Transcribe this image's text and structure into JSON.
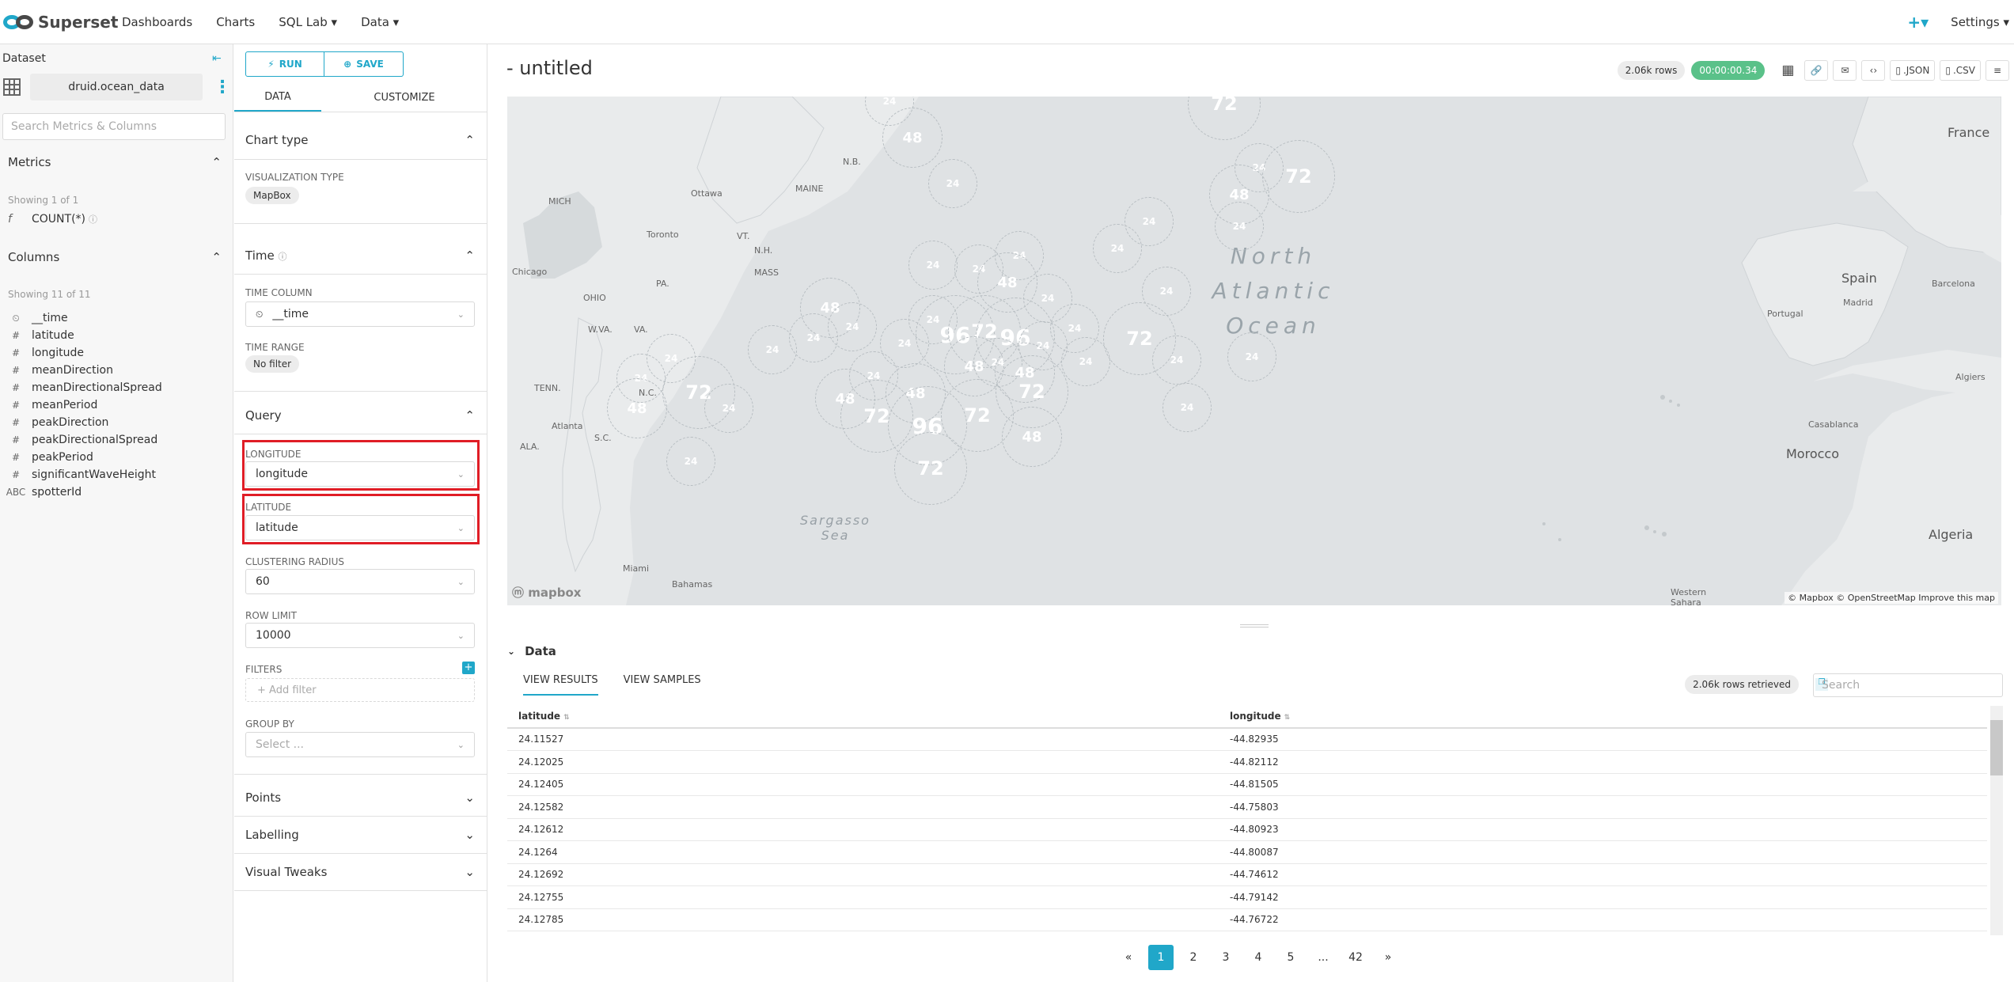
{
  "topbar": {
    "brand": "Superset",
    "nav": [
      "Dashboards",
      "Charts",
      "SQL Lab ▾",
      "Data ▾"
    ],
    "add_icon": "+▾",
    "settings": "Settings ▾"
  },
  "datasource": {
    "title": "Dataset",
    "name": "druid.ocean_data",
    "search_placeholder": "Search Metrics & Columns",
    "metrics_title": "Metrics",
    "metrics_showing": "Showing 1 of 1",
    "metrics": [
      {
        "icon": "f",
        "name": "COUNT(*)"
      }
    ],
    "columns_title": "Columns",
    "columns_showing": "Showing 11 of 11",
    "columns": [
      {
        "icon": "⏲",
        "name": "__time"
      },
      {
        "icon": "#",
        "name": "latitude"
      },
      {
        "icon": "#",
        "name": "longitude"
      },
      {
        "icon": "#",
        "name": "meanDirection"
      },
      {
        "icon": "#",
        "name": "meanDirectionalSpread"
      },
      {
        "icon": "#",
        "name": "meanPeriod"
      },
      {
        "icon": "#",
        "name": "peakDirection"
      },
      {
        "icon": "#",
        "name": "peakDirectionalSpread"
      },
      {
        "icon": "#",
        "name": "peakPeriod"
      },
      {
        "icon": "#",
        "name": "significantWaveHeight"
      },
      {
        "icon": "ABC",
        "name": "spotterId"
      }
    ]
  },
  "control_panel": {
    "run_label": "RUN",
    "save_label": "SAVE",
    "tabs": [
      "DATA",
      "CUSTOMIZE"
    ],
    "chart_type_title": "Chart type",
    "viz_type_label": "VISUALIZATION TYPE",
    "viz_type": "MapBox",
    "time_title": "Time",
    "time_column_label": "TIME COLUMN",
    "time_column": "__time",
    "time_range_label": "TIME RANGE",
    "time_range": "No filter",
    "query_title": "Query",
    "longitude_label": "LONGITUDE",
    "longitude": "longitude",
    "latitude_label": "LATITUDE",
    "latitude": "latitude",
    "radius_label": "CLUSTERING RADIUS",
    "radius": "60",
    "row_limit_label": "ROW LIMIT",
    "row_limit": "10000",
    "filters_label": "FILTERS",
    "add_filter": "+ Add filter",
    "group_by_label": "GROUP BY",
    "group_by_placeholder": "Select ...",
    "points_title": "Points",
    "labelling_title": "Labelling",
    "visual_tweaks_title": "Visual Tweaks"
  },
  "chart": {
    "title": "- untitled",
    "rows": "2.06k rows",
    "duration": "00:00:00.34",
    "json_btn": ".JSON",
    "csv_btn": ".CSV",
    "map": {
      "ocean_label": [
        "North",
        "Atlantic",
        "Ocean"
      ],
      "sargasso": [
        "Sargasso",
        "Sea"
      ],
      "attribution": "© Mapbox © OpenStreetMap  Improve this map",
      "logo": "mapbox",
      "countries": [
        "France",
        "Spain",
        "Morocco",
        "Algeria",
        "Portugal",
        "Western Sahara"
      ],
      "places": [
        "Ottawa",
        "Toronto",
        "Chicago",
        "MICH",
        "OHIO",
        "PA.",
        "MAINE",
        "N.B.",
        "VT.",
        "N.H.",
        "MASS",
        "VA.",
        "W.VA.",
        "TENN.",
        "N.C.",
        "Atlanta",
        "ALA.",
        "S.C.",
        "Miami",
        "Bahamas",
        "Madrid",
        "Barcelona",
        "Casablanca",
        "Algiers"
      ],
      "clusters": [
        {
          "count": 24
        },
        {
          "count": 48
        },
        {
          "count": 24
        },
        {
          "count": 24
        },
        {
          "count": 24
        },
        {
          "count": 48
        },
        {
          "count": 24
        },
        {
          "count": 24
        },
        {
          "count": 24
        },
        {
          "count": 24
        },
        {
          "count": 24
        },
        {
          "count": 24
        },
        {
          "count": 72
        },
        {
          "count": 48
        },
        {
          "count": 24
        },
        {
          "count": 24
        },
        {
          "count": 48
        },
        {
          "count": 48
        },
        {
          "count": 72
        },
        {
          "count": 96
        },
        {
          "count": 24
        },
        {
          "count": 24
        },
        {
          "count": 48
        },
        {
          "count": 24
        },
        {
          "count": 96
        },
        {
          "count": 72
        },
        {
          "count": 96
        },
        {
          "count": 24
        },
        {
          "count": 48
        },
        {
          "count": 24
        },
        {
          "count": 48
        },
        {
          "count": 24
        },
        {
          "count": 24
        },
        {
          "count": 72
        },
        {
          "count": 24
        },
        {
          "count": 72
        },
        {
          "count": 72
        },
        {
          "count": 48
        },
        {
          "count": 24
        },
        {
          "count": 72
        },
        {
          "count": 24
        },
        {
          "count": 72
        },
        {
          "count": 24
        },
        {
          "count": 48
        },
        {
          "count": 24
        },
        {
          "count": 24
        },
        {
          "count": 72
        },
        {
          "count": 24
        },
        {
          "count": 24
        },
        {
          "count": 24
        }
      ]
    }
  },
  "data_pane": {
    "title": "Data",
    "tabs": [
      "VIEW RESULTS",
      "VIEW SAMPLES"
    ],
    "rows_retrieved": "2.06k rows retrieved",
    "search_placeholder": "Search",
    "columns": [
      "latitude",
      "longitude"
    ],
    "rows": [
      [
        "24.11527",
        "-44.82935"
      ],
      [
        "24.12025",
        "-44.82112"
      ],
      [
        "24.12405",
        "-44.81505"
      ],
      [
        "24.12582",
        "-44.75803"
      ],
      [
        "24.12612",
        "-44.80923"
      ],
      [
        "24.1264",
        "-44.80087"
      ],
      [
        "24.12692",
        "-44.74612"
      ],
      [
        "24.12755",
        "-44.79142"
      ],
      [
        "24.12785",
        "-44.76722"
      ]
    ],
    "pagination": [
      "«",
      "1",
      "2",
      "3",
      "4",
      "5",
      "...",
      "42",
      "»"
    ],
    "active_page": "1"
  },
  "colors": {
    "accent": "#20a7c9",
    "success": "#5ac189",
    "highlight": "#e01d26",
    "cluster": "#b8bec2"
  }
}
